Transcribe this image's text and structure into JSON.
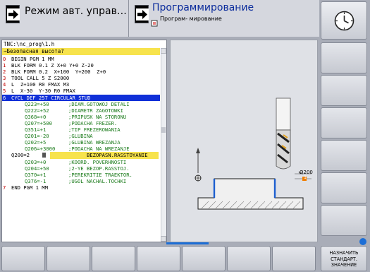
{
  "header": {
    "machine_mode_label": "Режим авт. управ…",
    "programming_mode_label": "Программирование",
    "programming_sub_label": "Програм- мирование"
  },
  "program": {
    "path": "TNC:\\nc_prog\\1.h",
    "prompt": "→Безопасная высота?",
    "lines": [
      {
        "ln": "0",
        "text": "BEGIN PGM 1 MM",
        "kind": "block"
      },
      {
        "ln": "1",
        "text": "BLK FORM 0.1 Z X+0 Y+0 Z-20",
        "kind": "block"
      },
      {
        "ln": "2",
        "text": "BLK FORM 0.2  X+100  Y+200  Z+0",
        "kind": "block"
      },
      {
        "ln": "3",
        "text": "TOOL CALL 5 Z S2000",
        "kind": "block"
      },
      {
        "ln": "4",
        "text": "L  Z+100 R0 FMAX M3",
        "kind": "block"
      },
      {
        "ln": "5",
        "text": "L  X-30  Y-30 R0 FMAX",
        "kind": "block"
      },
      {
        "ln": "6",
        "text": "CYCL DEF 257 CIRCULAR STUD",
        "kind": "selected"
      },
      {
        "ln": "",
        "text": "Q223=+50",
        "comment": ";DIAM.GOTOWOJ DETALI",
        "kind": "param"
      },
      {
        "ln": "",
        "text": "Q222=+52",
        "comment": ";DIAMETR ZAGOTOWKI",
        "kind": "param"
      },
      {
        "ln": "",
        "text": "Q368=+0",
        "comment": ";PRIPUSK NA STORONU",
        "kind": "param"
      },
      {
        "ln": "",
        "text": "Q207=+500",
        "comment": ";PODACHA FREZER.",
        "kind": "param"
      },
      {
        "ln": "",
        "text": "Q351=+1",
        "comment": ";TIP FREZEROWANIA",
        "kind": "param"
      },
      {
        "ln": "",
        "text": "Q201=-20",
        "comment": ";GLUBINA",
        "kind": "param"
      },
      {
        "ln": "",
        "text": "Q202=+5",
        "comment": ";GLUBINA WREZANJA",
        "kind": "param"
      },
      {
        "ln": "",
        "text": "Q206=+3000",
        "comment": ";PODACHA NA WREZANJE",
        "kind": "param"
      },
      {
        "ln": "",
        "text": "Q200=2",
        "comment": "BEZOPASN.RASSTOYANIE",
        "kind": "edit"
      },
      {
        "ln": "",
        "text": "Q203=+0",
        "comment": ";KOORD. POVERHNOSTI",
        "kind": "param"
      },
      {
        "ln": "",
        "text": "Q204=+50",
        "comment": ";2-YE BEZOP.RASSTOJ.",
        "kind": "param"
      },
      {
        "ln": "",
        "text": "Q370=+1",
        "comment": ";PEREKRITIE TRAEKTOR.",
        "kind": "param"
      },
      {
        "ln": "",
        "text": "Q376=-1",
        "comment": ";UGOL NACHAL.TOCHKI",
        "kind": "param"
      },
      {
        "ln": "7",
        "text": "END PGM 1 MM",
        "kind": "block"
      }
    ]
  },
  "graphic": {
    "param_label": "Q200",
    "marker_label": "1",
    "colors": {
      "workpiece_outline": "#1a1a1a",
      "wall": "#1c5fd0",
      "tool_flute": "#e0a020",
      "marker": "#f07e00"
    }
  },
  "softkeys": {
    "bottom": [
      "",
      "",
      "",
      "",
      "",
      "",
      "",
      "",
      "НАЗНАЧИТЬ СТАНДАРТ. ЗНАЧЕНИЕ"
    ]
  },
  "icons": {
    "clock": "clock-icon",
    "mode_arrow": "arrow-right-icon",
    "help": "help-icon"
  }
}
